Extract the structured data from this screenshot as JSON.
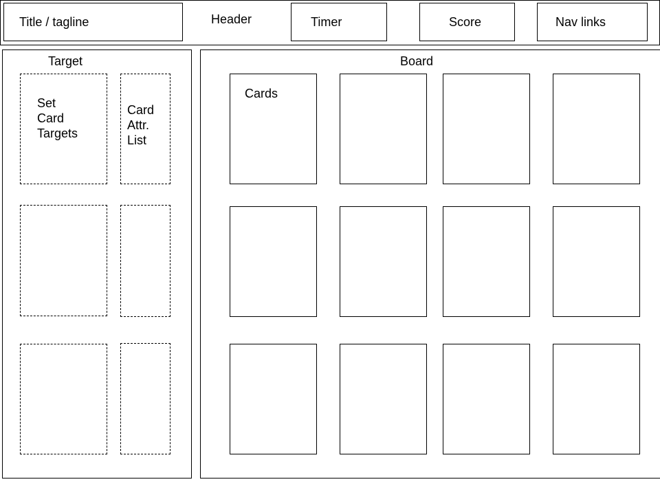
{
  "header": {
    "title_label": "Title / tagline",
    "header_label": "Header",
    "timer_label": "Timer",
    "score_label": "Score",
    "nav_label": "Nav links"
  },
  "target": {
    "label": "Target",
    "slots": [
      {
        "target_label": "Set\nCard\nTargets",
        "attr_label": "Card\nAttr.\nList"
      },
      {
        "target_label": "",
        "attr_label": ""
      },
      {
        "target_label": "",
        "attr_label": ""
      }
    ]
  },
  "board": {
    "label": "Board",
    "card_label": "Cards",
    "rows": 3,
    "columns": 4
  }
}
